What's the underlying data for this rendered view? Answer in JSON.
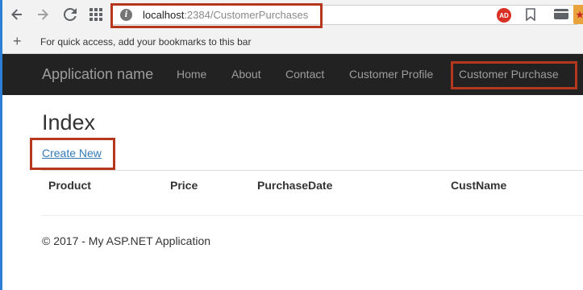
{
  "browser": {
    "address_bar": {
      "host": "localhost",
      "rest": ":2384/CustomerPurchases"
    },
    "ad_badge": "AD",
    "bookmarks_prompt": "For quick access, add your bookmarks to this bar",
    "extension_badge": "★"
  },
  "site": {
    "brand": "Application name",
    "nav": {
      "home": "Home",
      "about": "About",
      "contact": "Contact",
      "customer_profile": "Customer Profile",
      "customer_purchase": "Customer Purchase"
    },
    "page_title": "Index",
    "create_new": "Create New",
    "table": {
      "headers": [
        "Product",
        "Price",
        "PurchaseDate",
        "CustName"
      ],
      "rows": []
    },
    "footer": "© 2017 - My ASP.NET Application"
  },
  "colors": {
    "highlight_box": "#b5381e",
    "navbar_bg": "#222222",
    "nav_text": "#9d9d9d",
    "link": "#337ab7"
  },
  "icons": {
    "back": "back-arrow-icon",
    "forward": "forward-arrow-icon",
    "reload": "reload-icon",
    "apps": "apps-grid-icon",
    "site_info": "site-info-icon",
    "bookmark": "bookmark-star-icon",
    "payments": "credit-card-icon",
    "add_bookmark": "plus-icon"
  }
}
